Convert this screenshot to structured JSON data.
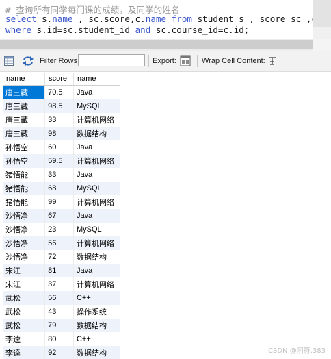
{
  "editor": {
    "comment": "# 查询所有同学每门课的成绩，及同学的姓名",
    "line2_kw1": "select",
    "line2_a": " s.",
    "line2_name1": "name",
    "line2_b": " , sc.score,c.",
    "line2_name2": "name",
    "line2_c": " ",
    "line2_kw2": "from",
    "line2_d": " student s , score sc ,course c",
    "line3_kw1": "where",
    "line3_a": " s.id=sc.student_id ",
    "line3_kw2": "and",
    "line3_b": " sc.course_id=c.id;"
  },
  "toolbar": {
    "filter_label": "Filter Rows:",
    "filter_value": "",
    "export_label": "Export:",
    "wrap_label": "Wrap Cell Content:"
  },
  "grid": {
    "columns": [
      "name",
      "score",
      "name"
    ],
    "rows": [
      [
        "唐三藏",
        "70.5",
        "Java"
      ],
      [
        "唐三藏",
        "98.5",
        "MySQL"
      ],
      [
        "唐三藏",
        "33",
        "计算机网络"
      ],
      [
        "唐三藏",
        "98",
        "数据结构"
      ],
      [
        "孙悟空",
        "60",
        "Java"
      ],
      [
        "孙悟空",
        "59.5",
        "计算机网络"
      ],
      [
        "猪悟能",
        "33",
        "Java"
      ],
      [
        "猪悟能",
        "68",
        "MySQL"
      ],
      [
        "猪悟能",
        "99",
        "计算机网络"
      ],
      [
        "沙悟净",
        "67",
        "Java"
      ],
      [
        "沙悟净",
        "23",
        "MySQL"
      ],
      [
        "沙悟净",
        "56",
        "计算机网络"
      ],
      [
        "沙悟净",
        "72",
        "数据结构"
      ],
      [
        "宋江",
        "81",
        "Java"
      ],
      [
        "宋江",
        "37",
        "计算机网络"
      ],
      [
        "武松",
        "56",
        "C++"
      ],
      [
        "武松",
        "43",
        "操作系统"
      ],
      [
        "武松",
        "79",
        "数据结构"
      ],
      [
        "李逵",
        "80",
        "C++"
      ],
      [
        "李逵",
        "92",
        "数据结构"
      ]
    ]
  },
  "watermark": "CSDN @阴符.383",
  "icons": {
    "grid": "result-grid-icon",
    "refresh": "refresh-icon",
    "export": "export-icon",
    "wrap": "wrap-cell-icon"
  },
  "colors": {
    "selection": "#0078d7",
    "row_alt": "#eef3fb",
    "keyword": "#3b57cc"
  }
}
